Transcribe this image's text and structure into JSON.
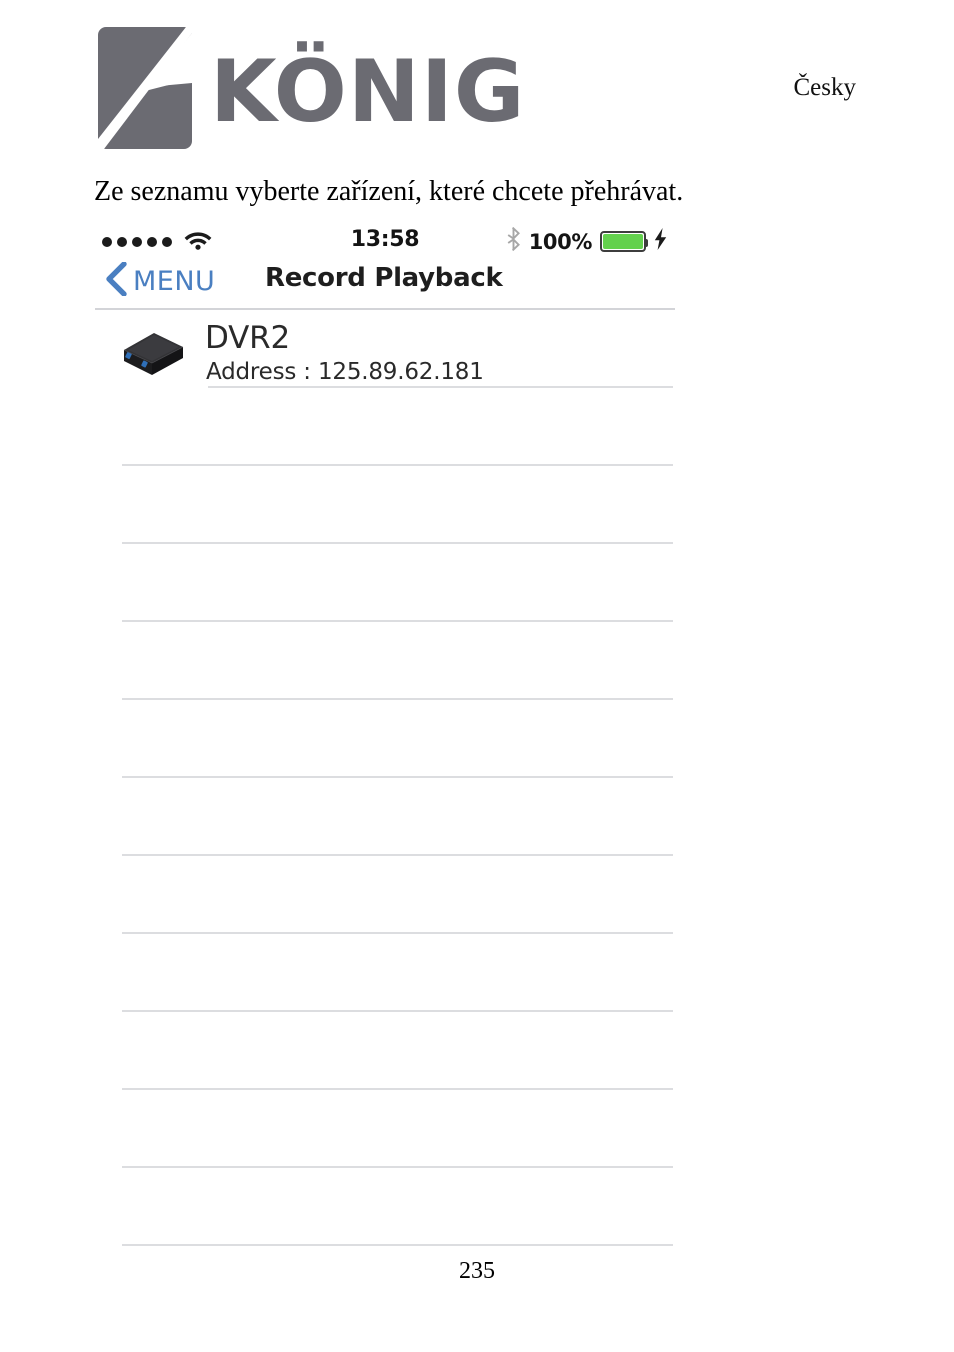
{
  "document": {
    "language_label": "Česky",
    "instruction": "Ze seznamu vyberte zařízení, které chcete přehrávat.",
    "page_number": "235",
    "brand": {
      "wordmark": "KÖNIG",
      "logo_color": "#6b6b72"
    }
  },
  "phone": {
    "status_bar": {
      "signal_dots": 5,
      "wifi_icon": "wifi-icon",
      "time": "13:58",
      "bluetooth_icon": "bluetooth-icon",
      "battery_percent": "100%",
      "battery_level": 100,
      "battery_color": "#63d14d",
      "charging_icon": "lightning-bolt-icon"
    },
    "nav_bar": {
      "back_icon": "chevron-left-icon",
      "back_label": "MENU",
      "title": "Record Playback",
      "accent_color": "#4a7fc1"
    },
    "list": {
      "devices": [
        {
          "icon": "dvr-device-icon",
          "name": "DVR2",
          "address": "Address : 125.89.62.181"
        }
      ],
      "empty_row_count": 11,
      "separator_color": "#dcdde0"
    }
  }
}
